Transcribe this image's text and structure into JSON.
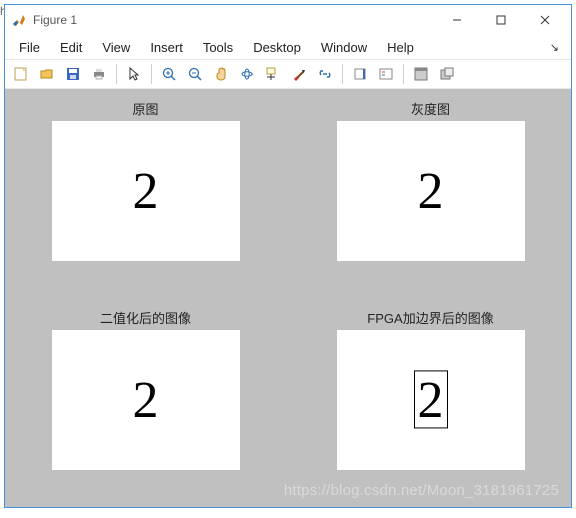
{
  "window": {
    "title": "Figure 1"
  },
  "menu": {
    "file": "File",
    "edit": "Edit",
    "view": "View",
    "insert": "Insert",
    "tools": "Tools",
    "desktop": "Desktop",
    "window": "Window",
    "help": "Help"
  },
  "toolbar_icons": [
    "new-figure-icon",
    "open-icon",
    "save-icon",
    "print-icon",
    "pointer-icon",
    "zoom-in-icon",
    "zoom-out-icon",
    "pan-icon",
    "rotate3d-icon",
    "datacursor-icon",
    "brush-icon",
    "link-icon",
    "colorbar-icon",
    "legend-icon",
    "layout-icon",
    "dock-icon",
    "undock-icon"
  ],
  "chart_data": [
    {
      "type": "table",
      "title": "原图",
      "content_label": "2",
      "description": "Original image showing handwritten digit 2"
    },
    {
      "type": "table",
      "title": "灰度图",
      "content_label": "2",
      "description": "Grayscale version of the image"
    },
    {
      "type": "table",
      "title": "二值化后的图像",
      "content_label": "2",
      "description": "Binarized (black/white thresholded) image"
    },
    {
      "type": "table",
      "title": "FPGA加边界后的图像",
      "content_label": "2",
      "description": "Image after FPGA bounding-box edge detection, with a rectangle drawn around the digit",
      "has_bounding_box": true
    }
  ],
  "watermark": "https://blog.csdn.net/Moon_3181961725"
}
